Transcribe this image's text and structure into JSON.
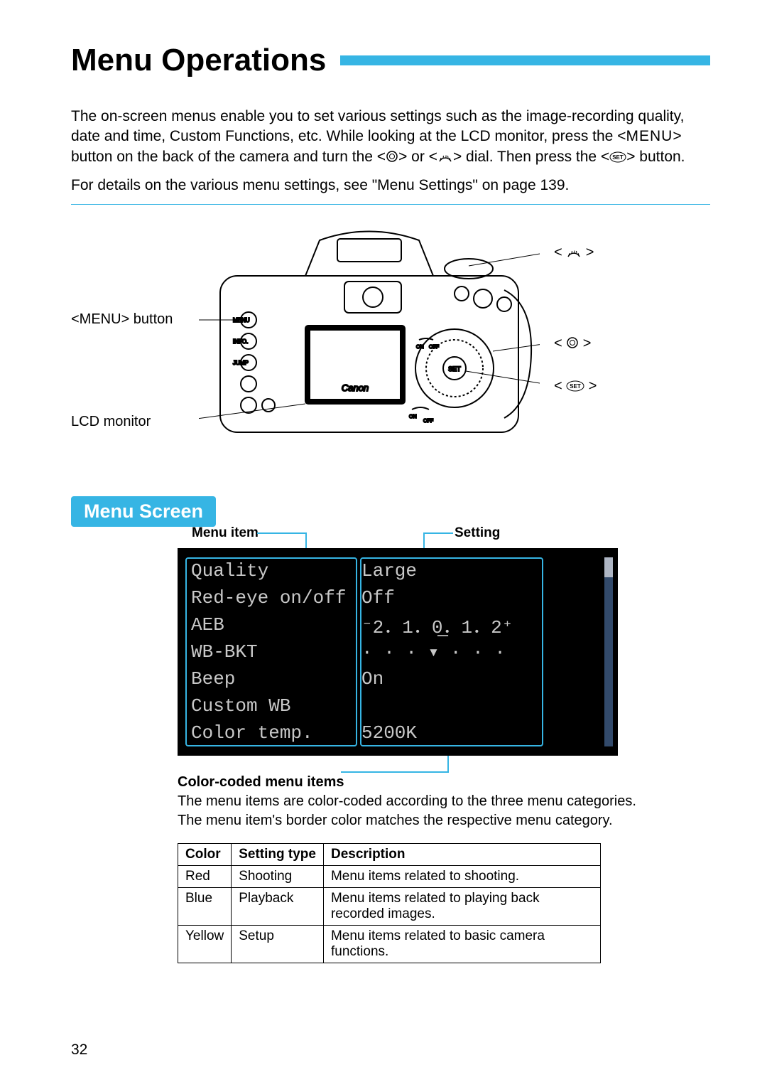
{
  "page": {
    "title": "Menu Operations",
    "intro_p1a": "The on-screen menus enable you to set various settings such as the image-recording quality, date and time, Custom Functions, etc. While looking at the LCD monitor, press the <",
    "intro_p1_menu": "MENU",
    "intro_p1b": "> button on the back of the camera and turn the <",
    "intro_p1c": "> or <",
    "intro_p1d": "> dial. Then press the <",
    "intro_p1e": "> button.",
    "intro_p2": "For details on the various menu settings, see \"Menu Settings\" on page 139.",
    "page_number": "32"
  },
  "diagram": {
    "menu_button": "<MENU> button",
    "lcd_monitor": "LCD monitor",
    "dial2": "< ⟳ >",
    "dial1": "< ⚙ >",
    "set": "< SET >"
  },
  "section": {
    "heading": "Menu Screen",
    "callout_item": "Menu item",
    "callout_setting": "Setting",
    "callout_color": "Color-coded menu items",
    "note": "The menu items are color-coded according to the three menu categories. The menu item's border color matches the respective menu category."
  },
  "lcd_rows": [
    {
      "name": "Quality",
      "value": "Large"
    },
    {
      "name": "Red-eye on/off",
      "value": "Off"
    },
    {
      "name": "AEB",
      "value": "⁻2．1．0̲．1．2⁺"
    },
    {
      "name": "WB-BKT",
      "value": "· · · ▾ · · ·"
    },
    {
      "name": "Beep",
      "value": "On"
    },
    {
      "name": "Custom WB",
      "value": ""
    },
    {
      "name": "Color temp.",
      "value": "5200K"
    }
  ],
  "table": {
    "headers": [
      "Color",
      "Setting type",
      "Description"
    ],
    "rows": [
      {
        "color": "Red",
        "type": "Shooting",
        "desc": "Menu items related to shooting."
      },
      {
        "color": "Blue",
        "type": "Playback",
        "desc": "Menu items related to playing back recorded images."
      },
      {
        "color": "Yellow",
        "type": "Setup",
        "desc": "Menu items related to basic camera functions."
      }
    ]
  }
}
